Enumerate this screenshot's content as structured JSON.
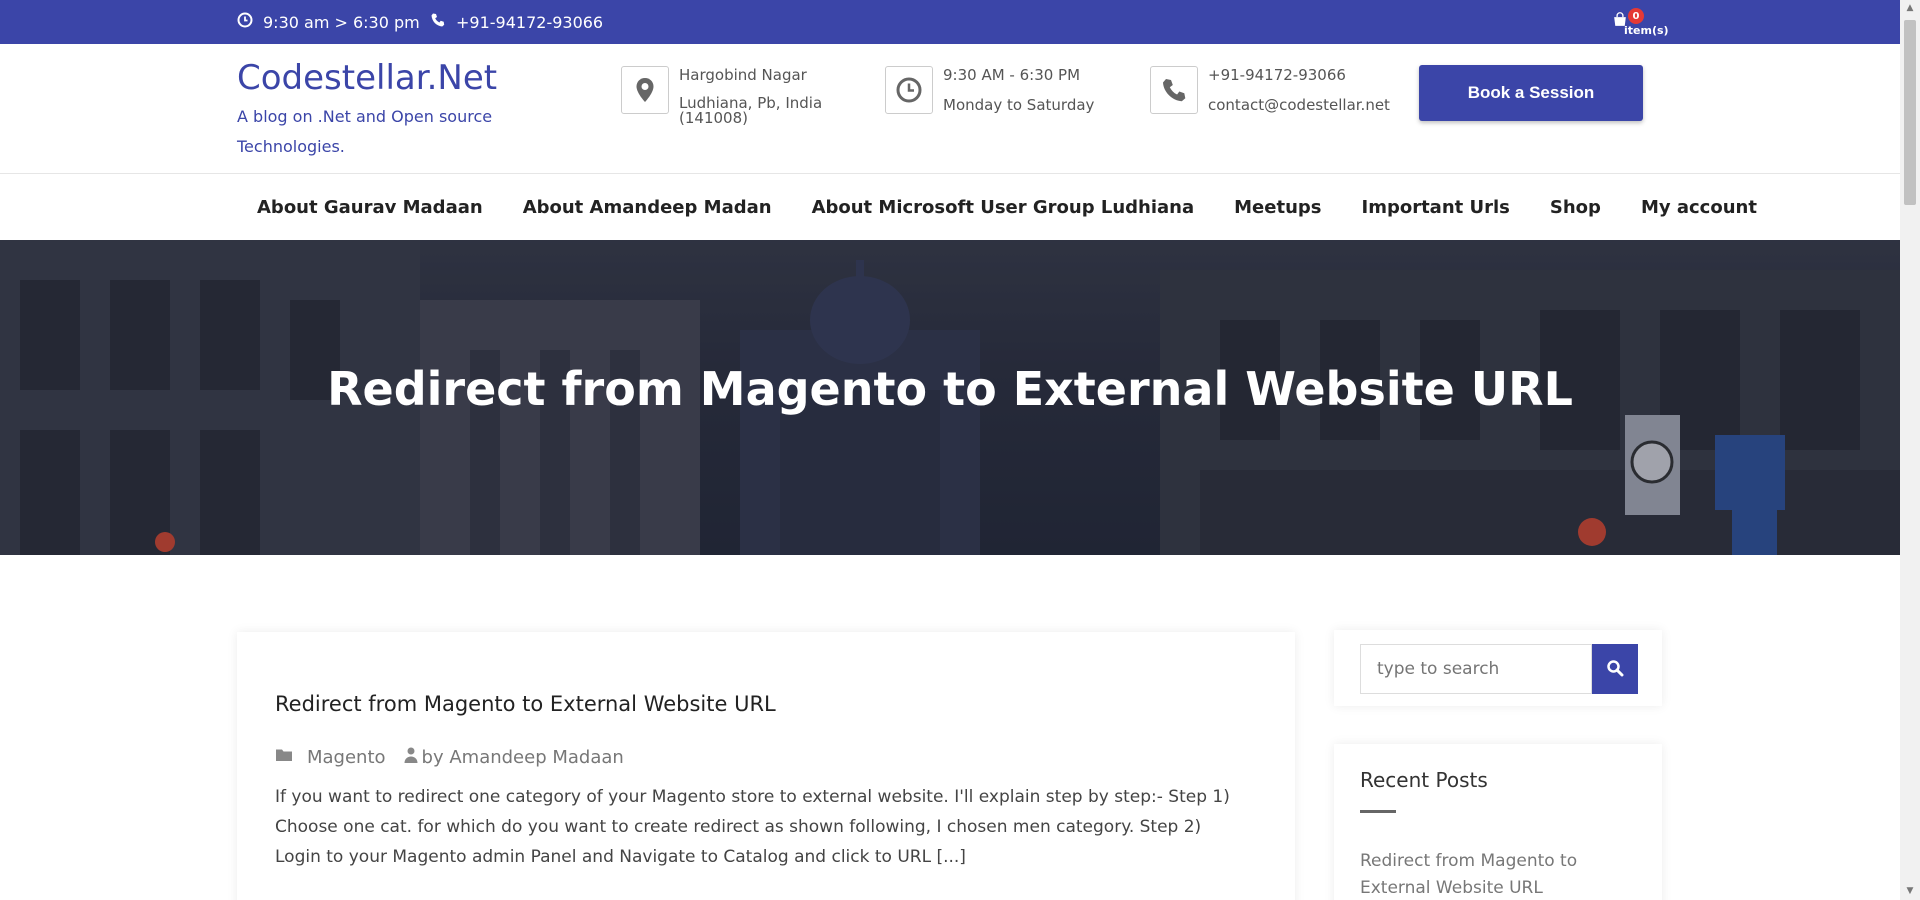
{
  "topbar": {
    "hours": "9:30 am > 6:30 pm",
    "phone": "+91-94172-93066",
    "cart_count": "0",
    "cart_label": "item(s)"
  },
  "header": {
    "logo": "Codestellar.Net",
    "tagline": "A blog on .Net and Open source Technologies.",
    "address_line1": "Hargobind Nagar",
    "address_line2": "Ludhiana, Pb, India (141008)",
    "time_line1": "9:30 AM - 6:30 PM",
    "time_line2": "Monday to Saturday",
    "contact_phone": "+91-94172-93066",
    "contact_email": "contact@codestellar.net",
    "book_button": "Book a Session"
  },
  "nav": {
    "items": [
      "About Gaurav Madaan",
      "About Amandeep Madan",
      "About Microsoft User Group Ludhiana",
      "Meetups",
      "Important Urls",
      "Shop",
      "My account"
    ]
  },
  "hero": {
    "title": "Redirect from Magento to External Website URL"
  },
  "post": {
    "title": "Redirect from Magento to External Website URL",
    "category": "Magento",
    "author": "by Amandeep Madaan",
    "excerpt": "If you want to redirect one category of your Magento store to external website. I'll explain step by step:- Step 1) Choose one cat. for which do you want to create redirect as shown following, I chosen men category. Step 2) Login to your Magento admin Panel and Navigate to Catalog and click to URL [...]"
  },
  "sidebar": {
    "search_placeholder": "type to search",
    "recent_title": "Recent Posts",
    "recent_posts": [
      "Redirect from Magento to External Website URL"
    ]
  },
  "colors": {
    "brand": "#3b45a8"
  },
  "icons": {
    "topbar_clock": "clock-icon",
    "topbar_phone": "phone-icon",
    "cart": "cart-icon",
    "address": "map-marker-icon",
    "hours": "clock-icon",
    "contact": "phone-icon",
    "category": "folder-icon",
    "author": "user-icon",
    "search": "search-icon"
  }
}
